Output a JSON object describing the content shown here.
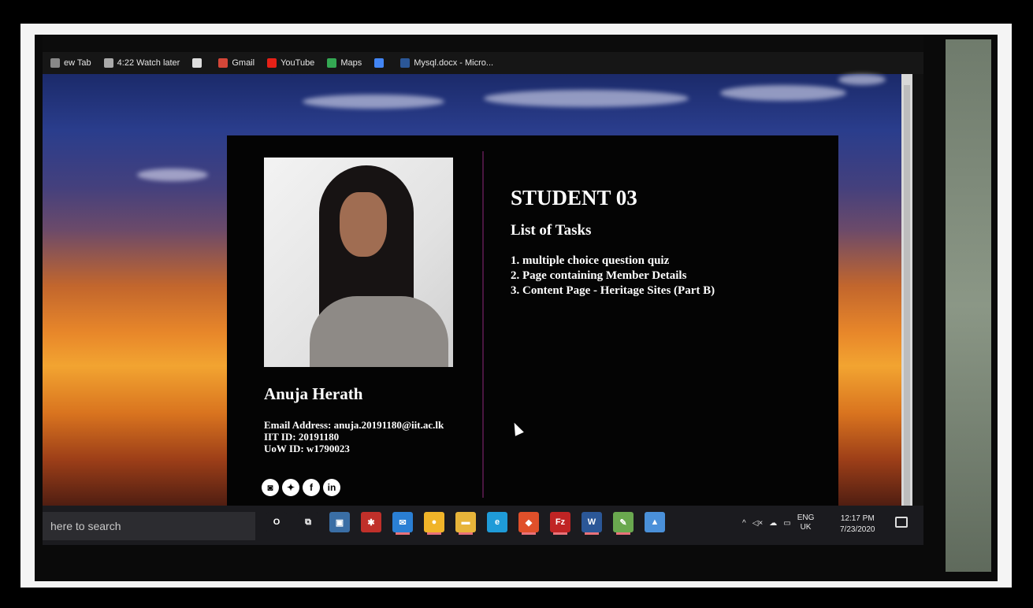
{
  "browser": {
    "bookmarks": [
      {
        "label": "ew Tab",
        "icon": "new-tab-icon"
      },
      {
        "label": "4:22 Watch later",
        "icon": "clock-icon"
      },
      {
        "label": "",
        "icon": "globe-icon"
      },
      {
        "label": "Gmail",
        "icon": "gmail-icon"
      },
      {
        "label": "YouTube",
        "icon": "youtube-icon"
      },
      {
        "label": "Maps",
        "icon": "maps-icon"
      },
      {
        "label": "",
        "icon": "google-icon"
      },
      {
        "label": "Mysql.docx - Micro...",
        "icon": "word-icon"
      }
    ]
  },
  "profile": {
    "name": "Anuja Herath",
    "email_line": "Email Address: anuja.20191180@iit.ac.lk",
    "iit_line": "IIT ID: 20191180",
    "uow_line": "UoW ID: w1790023",
    "socials": [
      {
        "icon": "instagram-icon",
        "glyph": "◙"
      },
      {
        "icon": "twitter-icon",
        "glyph": "✦"
      },
      {
        "icon": "facebook-icon",
        "glyph": "f"
      },
      {
        "icon": "linkedin-icon",
        "glyph": "in"
      }
    ]
  },
  "content": {
    "heading": "STUDENT 03",
    "subheading": "List of Tasks",
    "tasks": [
      "1. multiple choice question quiz",
      "2. Page containing Member Details",
      "3. Content Page - Heritage Sites (Part B)"
    ]
  },
  "taskbar": {
    "search_placeholder": "here to search",
    "apps": [
      {
        "name": "cortana-icon",
        "glyph": "O",
        "color": "#1b1b1f",
        "active": false
      },
      {
        "name": "task-view-icon",
        "glyph": "⧉",
        "color": "#1b1b1f",
        "active": false
      },
      {
        "name": "store-icon",
        "glyph": "▣",
        "color": "#3a6ea5",
        "active": false
      },
      {
        "name": "app-red-icon",
        "glyph": "✱",
        "color": "#c0302a",
        "active": false
      },
      {
        "name": "mail-icon",
        "glyph": "✉",
        "color": "#2a7fd4",
        "active": true
      },
      {
        "name": "chrome-icon",
        "glyph": "●",
        "color": "#f0b429",
        "active": true
      },
      {
        "name": "file-explorer-icon",
        "glyph": "▬",
        "color": "#e7b43a",
        "active": true
      },
      {
        "name": "edge-icon",
        "glyph": "e",
        "color": "#1f9bd8",
        "active": false
      },
      {
        "name": "office-icon",
        "glyph": "◆",
        "color": "#e0502a",
        "active": true
      },
      {
        "name": "filezilla-icon",
        "glyph": "Fz",
        "color": "#c02424",
        "active": true
      },
      {
        "name": "word-icon",
        "glyph": "W",
        "color": "#2b5797",
        "active": true
      },
      {
        "name": "notepad-icon",
        "glyph": "✎",
        "color": "#6aa84f",
        "active": true
      },
      {
        "name": "app-blue-icon",
        "glyph": "▲",
        "color": "#4a90d9",
        "active": false
      }
    ],
    "lang_top": "ENG",
    "lang_bottom": "UK",
    "time": "12:17 PM",
    "date": "7/23/2020"
  }
}
